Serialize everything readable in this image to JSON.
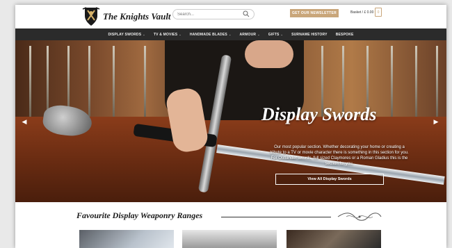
{
  "header": {
    "logo_text": "The Knights Vault",
    "search_placeholder": "Search...",
    "newsletter_label": "GET OUR NEWSLETTER",
    "basket_text": "Basket / £ 0.00",
    "basket_count": "0"
  },
  "nav": {
    "items": [
      {
        "label": "DISPLAY SWORDS",
        "has_dropdown": true
      },
      {
        "label": "TV & MOVIES",
        "has_dropdown": true
      },
      {
        "label": "HANDMADE BLADES",
        "has_dropdown": true
      },
      {
        "label": "ARMOUR",
        "has_dropdown": true
      },
      {
        "label": "GIFTS",
        "has_dropdown": true
      },
      {
        "label": "SURNAME HISTORY",
        "has_dropdown": false
      },
      {
        "label": "BESPOKE",
        "has_dropdown": false
      }
    ]
  },
  "hero": {
    "title": "Display Swords",
    "description": "Our most popular section. Whether decorating your home or creating a tribute to a TV or movie character there is something in this section for you. For Outlander swords, full sized Claymores or a Roman Gladius this is the section for you.",
    "button_label": "View All Display Swords",
    "prev_icon": "chevron-left-icon",
    "next_icon": "chevron-right-icon"
  },
  "section": {
    "title": "Favourite Display Weaponry Ranges"
  },
  "colors": {
    "accent": "#c9a67a",
    "nav_bg": "#2b2b2b"
  }
}
